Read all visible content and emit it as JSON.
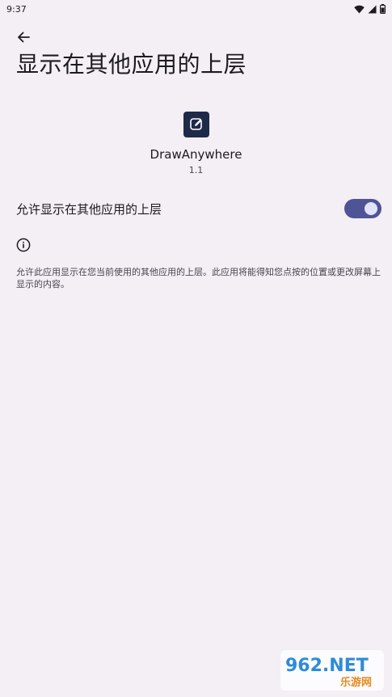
{
  "status_bar": {
    "time": "9:37",
    "icons": [
      "wifi-icon",
      "signal-icon",
      "battery-icon"
    ]
  },
  "header": {
    "back_icon": "arrow-back-icon",
    "title": "显示在其他应用的上层"
  },
  "app": {
    "icon": "edit-pen-icon",
    "name": "DrawAnywhere",
    "version": "1.1"
  },
  "permission": {
    "label": "允许显示在其他应用的上层",
    "enabled": true
  },
  "info": {
    "icon": "info-icon",
    "text": "允许此应用显示在您当前使用的其他应用的上层。此应用将能得知您点按的位置或更改屏幕上显示的内容。"
  },
  "watermark": {
    "logo_text": "962.NET",
    "sub_text": "乐游网"
  },
  "colors": {
    "background": "#F4EEF5",
    "switch_track": "#4F5496",
    "switch_thumb": "#E2E4FF",
    "app_icon_bg": "#1E2A4A"
  }
}
